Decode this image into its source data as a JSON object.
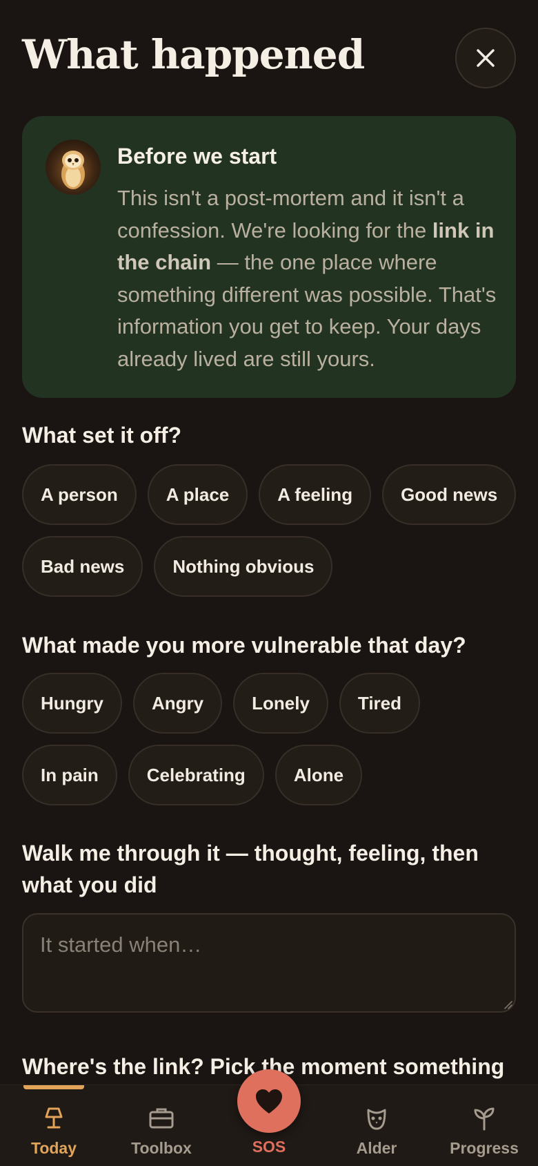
{
  "header": {
    "title": "What happened"
  },
  "intro": {
    "title": "Before we start",
    "body_1": "This isn't a post-mortem and it isn't a confession. We're looking for the ",
    "body_bold": "link in the chain",
    "body_2": " — the one place where something different was possible. That's information you get to keep. Your days already lived are still yours."
  },
  "triggers": {
    "label": "What set it off?",
    "options": [
      "A person",
      "A place",
      "A feeling",
      "Good news",
      "Bad news",
      "Nothing obvious"
    ]
  },
  "vulnerability": {
    "label": "What made you more vulnerable that day?",
    "options": [
      "Hungry",
      "Angry",
      "Lonely",
      "Tired",
      "In pain",
      "Celebrating",
      "Alone"
    ]
  },
  "walkthrough": {
    "label": "Walk me through it — thought, feeling, then what you did",
    "placeholder": "It started when…",
    "value": ""
  },
  "link": {
    "label": "Where's the link? Pick the moment something"
  },
  "nav": {
    "items": [
      {
        "label": "Today",
        "icon": "lamp-icon",
        "active": true
      },
      {
        "label": "Toolbox",
        "icon": "briefcase-icon",
        "active": false
      },
      {
        "label": "SOS",
        "icon": "heart-icon",
        "active": false
      },
      {
        "label": "Alder",
        "icon": "owl-face-icon",
        "active": false
      },
      {
        "label": "Progress",
        "icon": "sprout-icon",
        "active": false
      }
    ]
  },
  "colors": {
    "background": "#1a1512",
    "card_green": "#233322",
    "accent_amber": "#e2a458",
    "sos_coral": "#e0705e"
  }
}
